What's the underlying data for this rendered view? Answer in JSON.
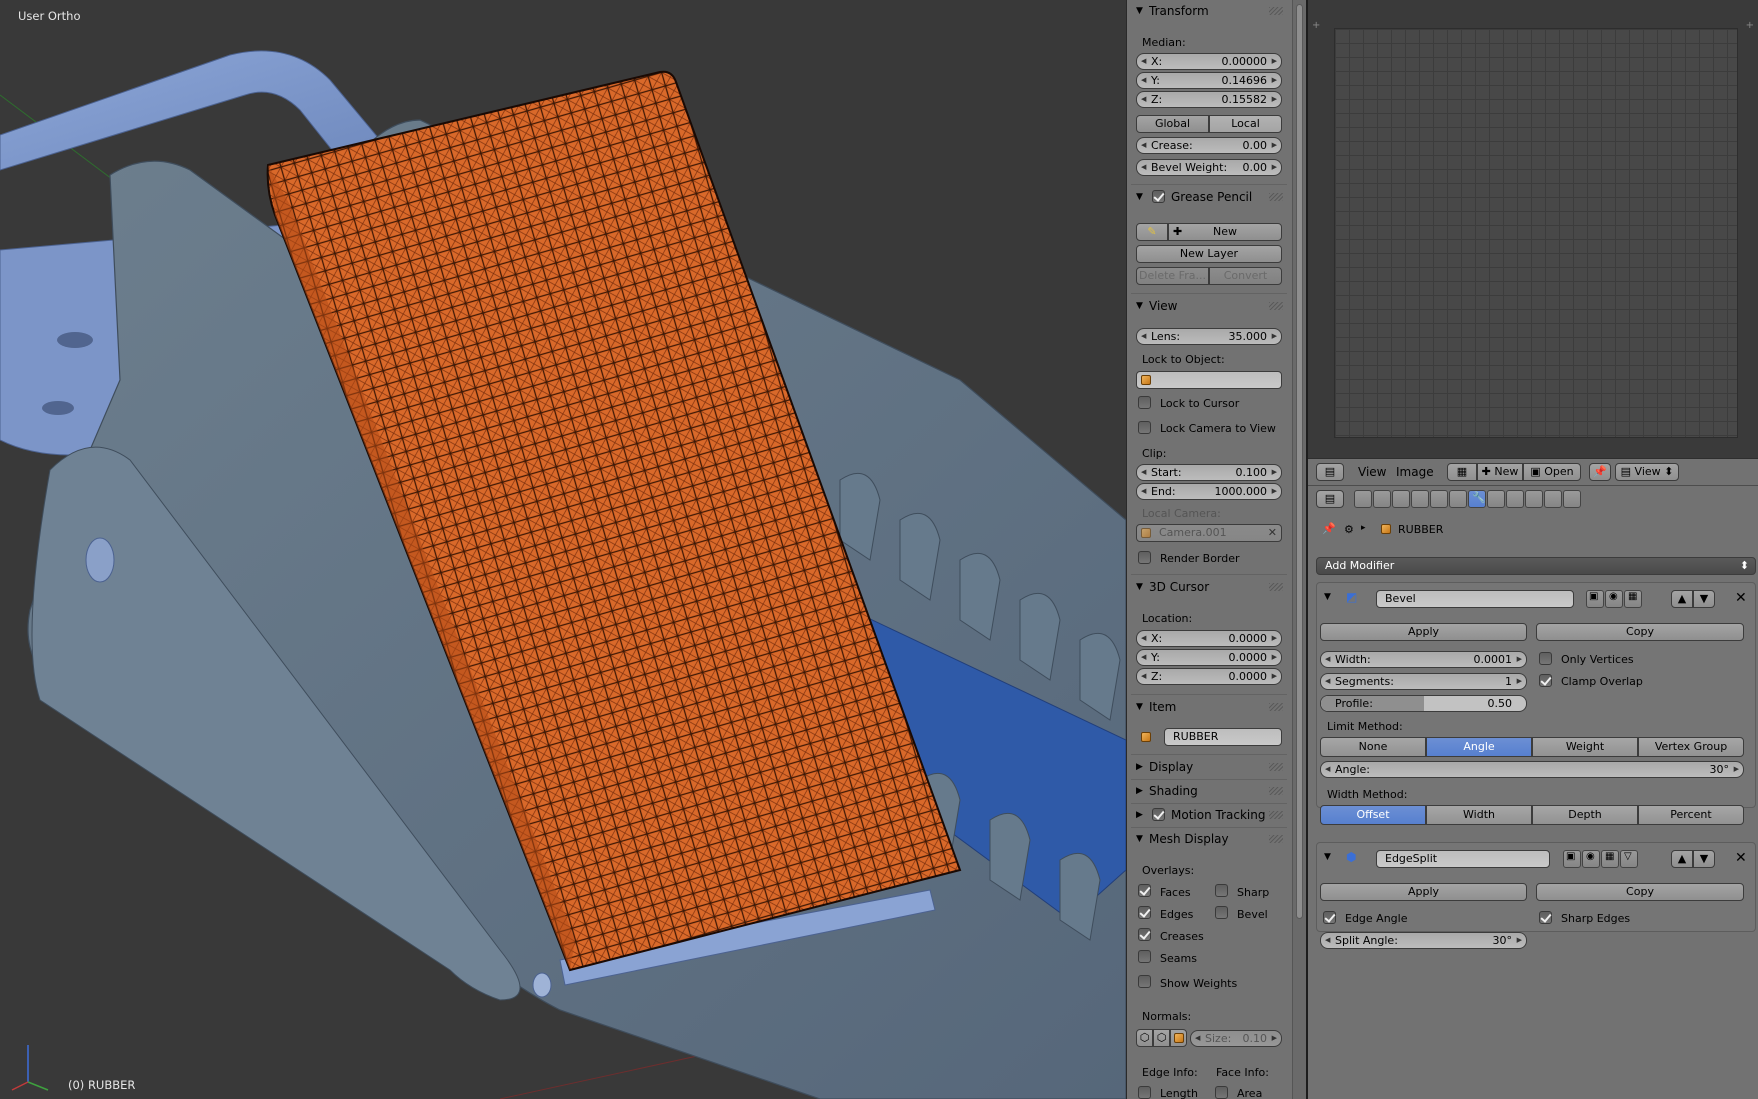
{
  "viewport": {
    "view_label": "User Ortho",
    "object_label": "(0) RUBBER"
  },
  "npanel": {
    "transform": {
      "header": "Transform",
      "median_label": "Median:",
      "x": {
        "key": "X:",
        "value": "0.00000"
      },
      "y": {
        "key": "Y:",
        "value": "0.14696"
      },
      "z": {
        "key": "Z:",
        "value": "0.15582"
      },
      "global": "Global",
      "local": "Local",
      "crease": {
        "key": "Crease:",
        "value": "0.00"
      },
      "bevel_weight": {
        "key": "Bevel Weight:",
        "value": "0.00"
      }
    },
    "grease_pencil": {
      "header": "Grease Pencil",
      "new": "New",
      "new_layer": "New Layer",
      "delete_frame": "Delete Fra...",
      "convert": "Convert"
    },
    "view": {
      "header": "View",
      "lens": {
        "key": "Lens:",
        "value": "35.000"
      },
      "lock_to_object": "Lock to Object:",
      "lock_to_cursor": "Lock to Cursor",
      "lock_camera_to_view": "Lock Camera to View",
      "clip_label": "Clip:",
      "start": {
        "key": "Start:",
        "value": "0.100"
      },
      "end": {
        "key": "End:",
        "value": "1000.000"
      },
      "local_camera": "Local Camera:",
      "camera_value": "Camera.001",
      "render_border": "Render Border"
    },
    "cursor": {
      "header": "3D Cursor",
      "location_label": "Location:",
      "x": {
        "key": "X:",
        "value": "0.0000"
      },
      "y": {
        "key": "Y:",
        "value": "0.0000"
      },
      "z": {
        "key": "Z:",
        "value": "0.0000"
      }
    },
    "item": {
      "header": "Item",
      "name": "RUBBER"
    },
    "display_header": "Display",
    "shading_header": "Shading",
    "motion_tracking_header": "Motion Tracking",
    "mesh_display": {
      "header": "Mesh Display",
      "overlays_label": "Overlays:",
      "faces": "Faces",
      "sharp": "Sharp",
      "edges": "Edges",
      "bevel": "Bevel",
      "creases": "Creases",
      "seams": "Seams",
      "show_weights": "Show Weights",
      "normals_label": "Normals:",
      "size": {
        "key": "Size:",
        "value": "0.10"
      },
      "edge_info": "Edge Info:",
      "face_info": "Face Info:",
      "length": "Length",
      "area": "Area"
    }
  },
  "image_editor": {
    "menu_view": "View",
    "menu_image": "Image",
    "new": "New",
    "open": "Open",
    "view_dropdown": "View"
  },
  "properties": {
    "object_name": "RUBBER",
    "add_modifier": "Add Modifier",
    "bevel": {
      "name": "Bevel",
      "apply": "Apply",
      "copy": "Copy",
      "width": {
        "key": "Width:",
        "value": "0.0001"
      },
      "segments": {
        "key": "Segments:",
        "value": "1"
      },
      "profile": {
        "key": "Profile:",
        "value": "0.50",
        "fraction": 0.5
      },
      "only_vertices": "Only Vertices",
      "clamp_overlap": "Clamp Overlap",
      "limit_method_label": "Limit Method:",
      "limit_methods": [
        "None",
        "Angle",
        "Weight",
        "Vertex Group"
      ],
      "limit_selected": "Angle",
      "angle": {
        "key": "Angle:",
        "value": "30°"
      },
      "width_method_label": "Width Method:",
      "width_methods": [
        "Offset",
        "Width",
        "Depth",
        "Percent"
      ],
      "width_selected": "Offset"
    },
    "edgesplit": {
      "name": "EdgeSplit",
      "apply": "Apply",
      "copy": "Copy",
      "edge_angle": "Edge Angle",
      "sharp_edges": "Sharp Edges",
      "split_angle": {
        "key": "Split Angle:",
        "value": "30°"
      }
    }
  },
  "colors": {
    "accent_blue": "#5780cf",
    "panel_grey": "#727272",
    "rubber_orange": "#c8551c"
  }
}
